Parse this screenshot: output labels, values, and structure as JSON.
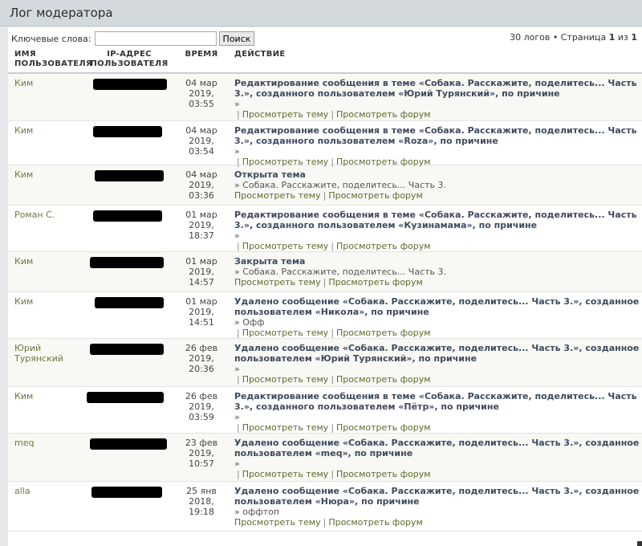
{
  "page_title": "Лог модератора",
  "search": {
    "label": "Ключевые слова:",
    "value": "",
    "button": "Поиск"
  },
  "pager": {
    "count_text": "30 логов • Страница",
    "current": "1",
    "of": "из",
    "total": "1"
  },
  "columns": {
    "user": "ИМЯ ПОЛЬЗОВАТЕЛЯ",
    "ip": "IP-АДРЕС ПОЛЬЗОВАТЕЛЯ",
    "time": "ВРЕМЯ",
    "action": "ДЕЙСТВИЕ"
  },
  "links": {
    "view_topic": "Просмотреть тему",
    "view_forum": "Просмотреть форум"
  },
  "rows": [
    {
      "user": "Ким",
      "date": "04 мар",
      "year": "2019,",
      "clock": "03:55",
      "action": "Редактирование сообщения в теме «Собака. Расскажите, поделитесь... Часть 3.», созданного пользователем «Юрий Турянский», по причине",
      "reason": "»",
      "lead_sep": true
    },
    {
      "user": "Ким",
      "date": "04 мар",
      "year": "2019,",
      "clock": "03:54",
      "action": "Редактирование сообщения в теме «Собака. Расскажите, поделитесь... Часть 3.», созданного пользователем «Roza», по причине",
      "reason": "»",
      "lead_sep": true
    },
    {
      "user": "Ким",
      "date": "04 мар",
      "year": "2019,",
      "clock": "03:36",
      "action": "Открыта тема",
      "reason": "» Собака. Расскажите, поделитесь... Часть 3.",
      "lead_sep": false
    },
    {
      "user": "Роман С.",
      "date": "01 мар",
      "year": "2019,",
      "clock": "18:37",
      "action": "Редактирование сообщения в теме «Собака. Расскажите, поделитесь... Часть 3.», созданного пользователем «Кузинамама», по причине",
      "reason": "»",
      "lead_sep": true
    },
    {
      "user": "Ким",
      "date": "01 мар",
      "year": "2019,",
      "clock": "14:57",
      "action": "Закрыта тема",
      "reason": "» Собака. Расскажите, поделитесь... Часть 3.",
      "lead_sep": false
    },
    {
      "user": "Ким",
      "date": "01 мар",
      "year": "2019,",
      "clock": "14:51",
      "action": "Удалено сообщение «Собака. Расскажите, поделитесь... Часть 3.», созданное пользователем «Никола», по причине",
      "reason": "» Офф",
      "lead_sep": true
    },
    {
      "user": "Юрий Турянский",
      "date": "26 фев",
      "year": "2019,",
      "clock": "20:36",
      "action": "Удалено сообщение «Собака. Расскажите, поделитесь... Часть 3.», созданное пользователем «Юрий Турянский», по причине",
      "reason": "»",
      "lead_sep": true
    },
    {
      "user": "Ким",
      "date": "26 фев",
      "year": "2019,",
      "clock": "03:59",
      "action": "Редактирование сообщения в теме «Собака. Расскажите, поделитесь... Часть 3.», созданного пользователем «Пётр», по причине",
      "reason": "»",
      "lead_sep": true
    },
    {
      "user": "meq",
      "date": "23 фев",
      "year": "2019,",
      "clock": "10:57",
      "action": "Удалено сообщение «Собака. Расскажите, поделитесь... Часть 3.», созданное пользователем «meq», по причине",
      "reason": "»",
      "lead_sep": true
    },
    {
      "user": "alla",
      "date": "25 янв",
      "year": "2018,",
      "clock": "19:18",
      "action": "Удалено сообщение «Собака. Расскажите, поделитесь... Часть 3.», созданное пользователем «Нюра», по причине",
      "reason": "» оффтоп",
      "lead_sep": false
    }
  ]
}
